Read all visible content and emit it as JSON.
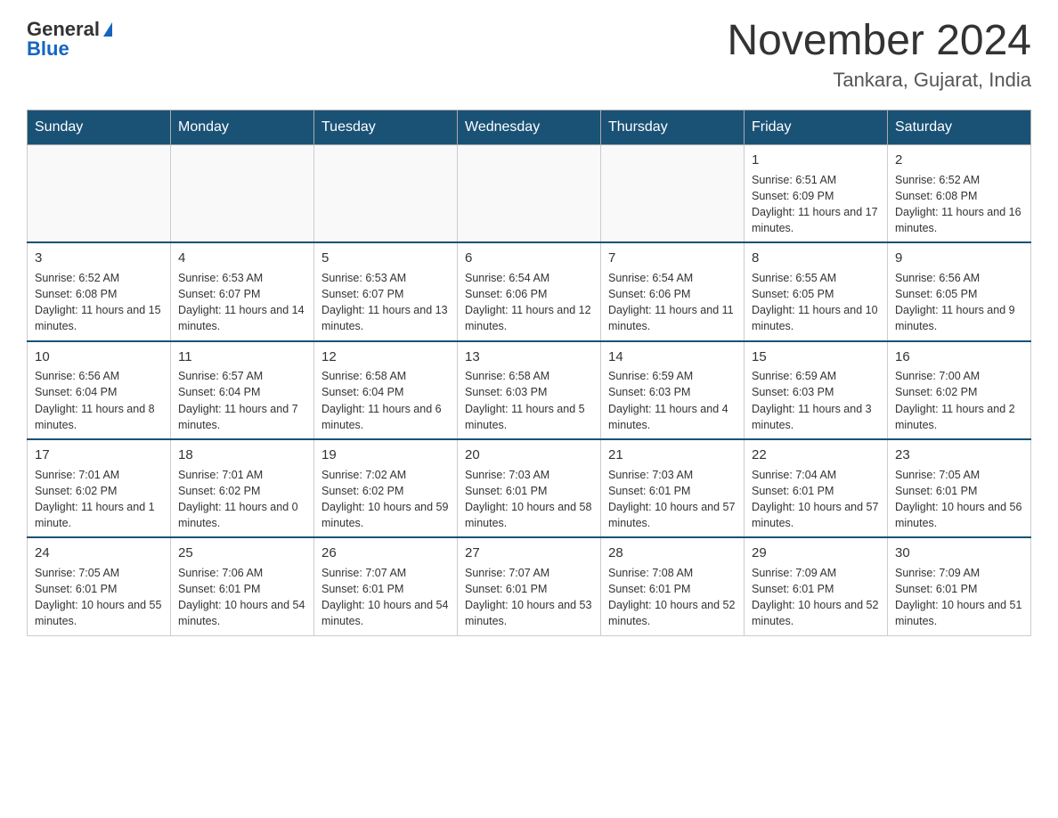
{
  "logo": {
    "general": "General",
    "blue": "Blue"
  },
  "title": "November 2024",
  "location": "Tankara, Gujarat, India",
  "days_of_week": [
    "Sunday",
    "Monday",
    "Tuesday",
    "Wednesday",
    "Thursday",
    "Friday",
    "Saturday"
  ],
  "weeks": [
    [
      {
        "day": "",
        "sunrise": "",
        "sunset": "",
        "daylight": "",
        "empty": true
      },
      {
        "day": "",
        "sunrise": "",
        "sunset": "",
        "daylight": "",
        "empty": true
      },
      {
        "day": "",
        "sunrise": "",
        "sunset": "",
        "daylight": "",
        "empty": true
      },
      {
        "day": "",
        "sunrise": "",
        "sunset": "",
        "daylight": "",
        "empty": true
      },
      {
        "day": "",
        "sunrise": "",
        "sunset": "",
        "daylight": "",
        "empty": true
      },
      {
        "day": "1",
        "sunrise": "Sunrise: 6:51 AM",
        "sunset": "Sunset: 6:09 PM",
        "daylight": "Daylight: 11 hours and 17 minutes.",
        "empty": false
      },
      {
        "day": "2",
        "sunrise": "Sunrise: 6:52 AM",
        "sunset": "Sunset: 6:08 PM",
        "daylight": "Daylight: 11 hours and 16 minutes.",
        "empty": false
      }
    ],
    [
      {
        "day": "3",
        "sunrise": "Sunrise: 6:52 AM",
        "sunset": "Sunset: 6:08 PM",
        "daylight": "Daylight: 11 hours and 15 minutes.",
        "empty": false
      },
      {
        "day": "4",
        "sunrise": "Sunrise: 6:53 AM",
        "sunset": "Sunset: 6:07 PM",
        "daylight": "Daylight: 11 hours and 14 minutes.",
        "empty": false
      },
      {
        "day": "5",
        "sunrise": "Sunrise: 6:53 AM",
        "sunset": "Sunset: 6:07 PM",
        "daylight": "Daylight: 11 hours and 13 minutes.",
        "empty": false
      },
      {
        "day": "6",
        "sunrise": "Sunrise: 6:54 AM",
        "sunset": "Sunset: 6:06 PM",
        "daylight": "Daylight: 11 hours and 12 minutes.",
        "empty": false
      },
      {
        "day": "7",
        "sunrise": "Sunrise: 6:54 AM",
        "sunset": "Sunset: 6:06 PM",
        "daylight": "Daylight: 11 hours and 11 minutes.",
        "empty": false
      },
      {
        "day": "8",
        "sunrise": "Sunrise: 6:55 AM",
        "sunset": "Sunset: 6:05 PM",
        "daylight": "Daylight: 11 hours and 10 minutes.",
        "empty": false
      },
      {
        "day": "9",
        "sunrise": "Sunrise: 6:56 AM",
        "sunset": "Sunset: 6:05 PM",
        "daylight": "Daylight: 11 hours and 9 minutes.",
        "empty": false
      }
    ],
    [
      {
        "day": "10",
        "sunrise": "Sunrise: 6:56 AM",
        "sunset": "Sunset: 6:04 PM",
        "daylight": "Daylight: 11 hours and 8 minutes.",
        "empty": false
      },
      {
        "day": "11",
        "sunrise": "Sunrise: 6:57 AM",
        "sunset": "Sunset: 6:04 PM",
        "daylight": "Daylight: 11 hours and 7 minutes.",
        "empty": false
      },
      {
        "day": "12",
        "sunrise": "Sunrise: 6:58 AM",
        "sunset": "Sunset: 6:04 PM",
        "daylight": "Daylight: 11 hours and 6 minutes.",
        "empty": false
      },
      {
        "day": "13",
        "sunrise": "Sunrise: 6:58 AM",
        "sunset": "Sunset: 6:03 PM",
        "daylight": "Daylight: 11 hours and 5 minutes.",
        "empty": false
      },
      {
        "day": "14",
        "sunrise": "Sunrise: 6:59 AM",
        "sunset": "Sunset: 6:03 PM",
        "daylight": "Daylight: 11 hours and 4 minutes.",
        "empty": false
      },
      {
        "day": "15",
        "sunrise": "Sunrise: 6:59 AM",
        "sunset": "Sunset: 6:03 PM",
        "daylight": "Daylight: 11 hours and 3 minutes.",
        "empty": false
      },
      {
        "day": "16",
        "sunrise": "Sunrise: 7:00 AM",
        "sunset": "Sunset: 6:02 PM",
        "daylight": "Daylight: 11 hours and 2 minutes.",
        "empty": false
      }
    ],
    [
      {
        "day": "17",
        "sunrise": "Sunrise: 7:01 AM",
        "sunset": "Sunset: 6:02 PM",
        "daylight": "Daylight: 11 hours and 1 minute.",
        "empty": false
      },
      {
        "day": "18",
        "sunrise": "Sunrise: 7:01 AM",
        "sunset": "Sunset: 6:02 PM",
        "daylight": "Daylight: 11 hours and 0 minutes.",
        "empty": false
      },
      {
        "day": "19",
        "sunrise": "Sunrise: 7:02 AM",
        "sunset": "Sunset: 6:02 PM",
        "daylight": "Daylight: 10 hours and 59 minutes.",
        "empty": false
      },
      {
        "day": "20",
        "sunrise": "Sunrise: 7:03 AM",
        "sunset": "Sunset: 6:01 PM",
        "daylight": "Daylight: 10 hours and 58 minutes.",
        "empty": false
      },
      {
        "day": "21",
        "sunrise": "Sunrise: 7:03 AM",
        "sunset": "Sunset: 6:01 PM",
        "daylight": "Daylight: 10 hours and 57 minutes.",
        "empty": false
      },
      {
        "day": "22",
        "sunrise": "Sunrise: 7:04 AM",
        "sunset": "Sunset: 6:01 PM",
        "daylight": "Daylight: 10 hours and 57 minutes.",
        "empty": false
      },
      {
        "day": "23",
        "sunrise": "Sunrise: 7:05 AM",
        "sunset": "Sunset: 6:01 PM",
        "daylight": "Daylight: 10 hours and 56 minutes.",
        "empty": false
      }
    ],
    [
      {
        "day": "24",
        "sunrise": "Sunrise: 7:05 AM",
        "sunset": "Sunset: 6:01 PM",
        "daylight": "Daylight: 10 hours and 55 minutes.",
        "empty": false
      },
      {
        "day": "25",
        "sunrise": "Sunrise: 7:06 AM",
        "sunset": "Sunset: 6:01 PM",
        "daylight": "Daylight: 10 hours and 54 minutes.",
        "empty": false
      },
      {
        "day": "26",
        "sunrise": "Sunrise: 7:07 AM",
        "sunset": "Sunset: 6:01 PM",
        "daylight": "Daylight: 10 hours and 54 minutes.",
        "empty": false
      },
      {
        "day": "27",
        "sunrise": "Sunrise: 7:07 AM",
        "sunset": "Sunset: 6:01 PM",
        "daylight": "Daylight: 10 hours and 53 minutes.",
        "empty": false
      },
      {
        "day": "28",
        "sunrise": "Sunrise: 7:08 AM",
        "sunset": "Sunset: 6:01 PM",
        "daylight": "Daylight: 10 hours and 52 minutes.",
        "empty": false
      },
      {
        "day": "29",
        "sunrise": "Sunrise: 7:09 AM",
        "sunset": "Sunset: 6:01 PM",
        "daylight": "Daylight: 10 hours and 52 minutes.",
        "empty": false
      },
      {
        "day": "30",
        "sunrise": "Sunrise: 7:09 AM",
        "sunset": "Sunset: 6:01 PM",
        "daylight": "Daylight: 10 hours and 51 minutes.",
        "empty": false
      }
    ]
  ]
}
